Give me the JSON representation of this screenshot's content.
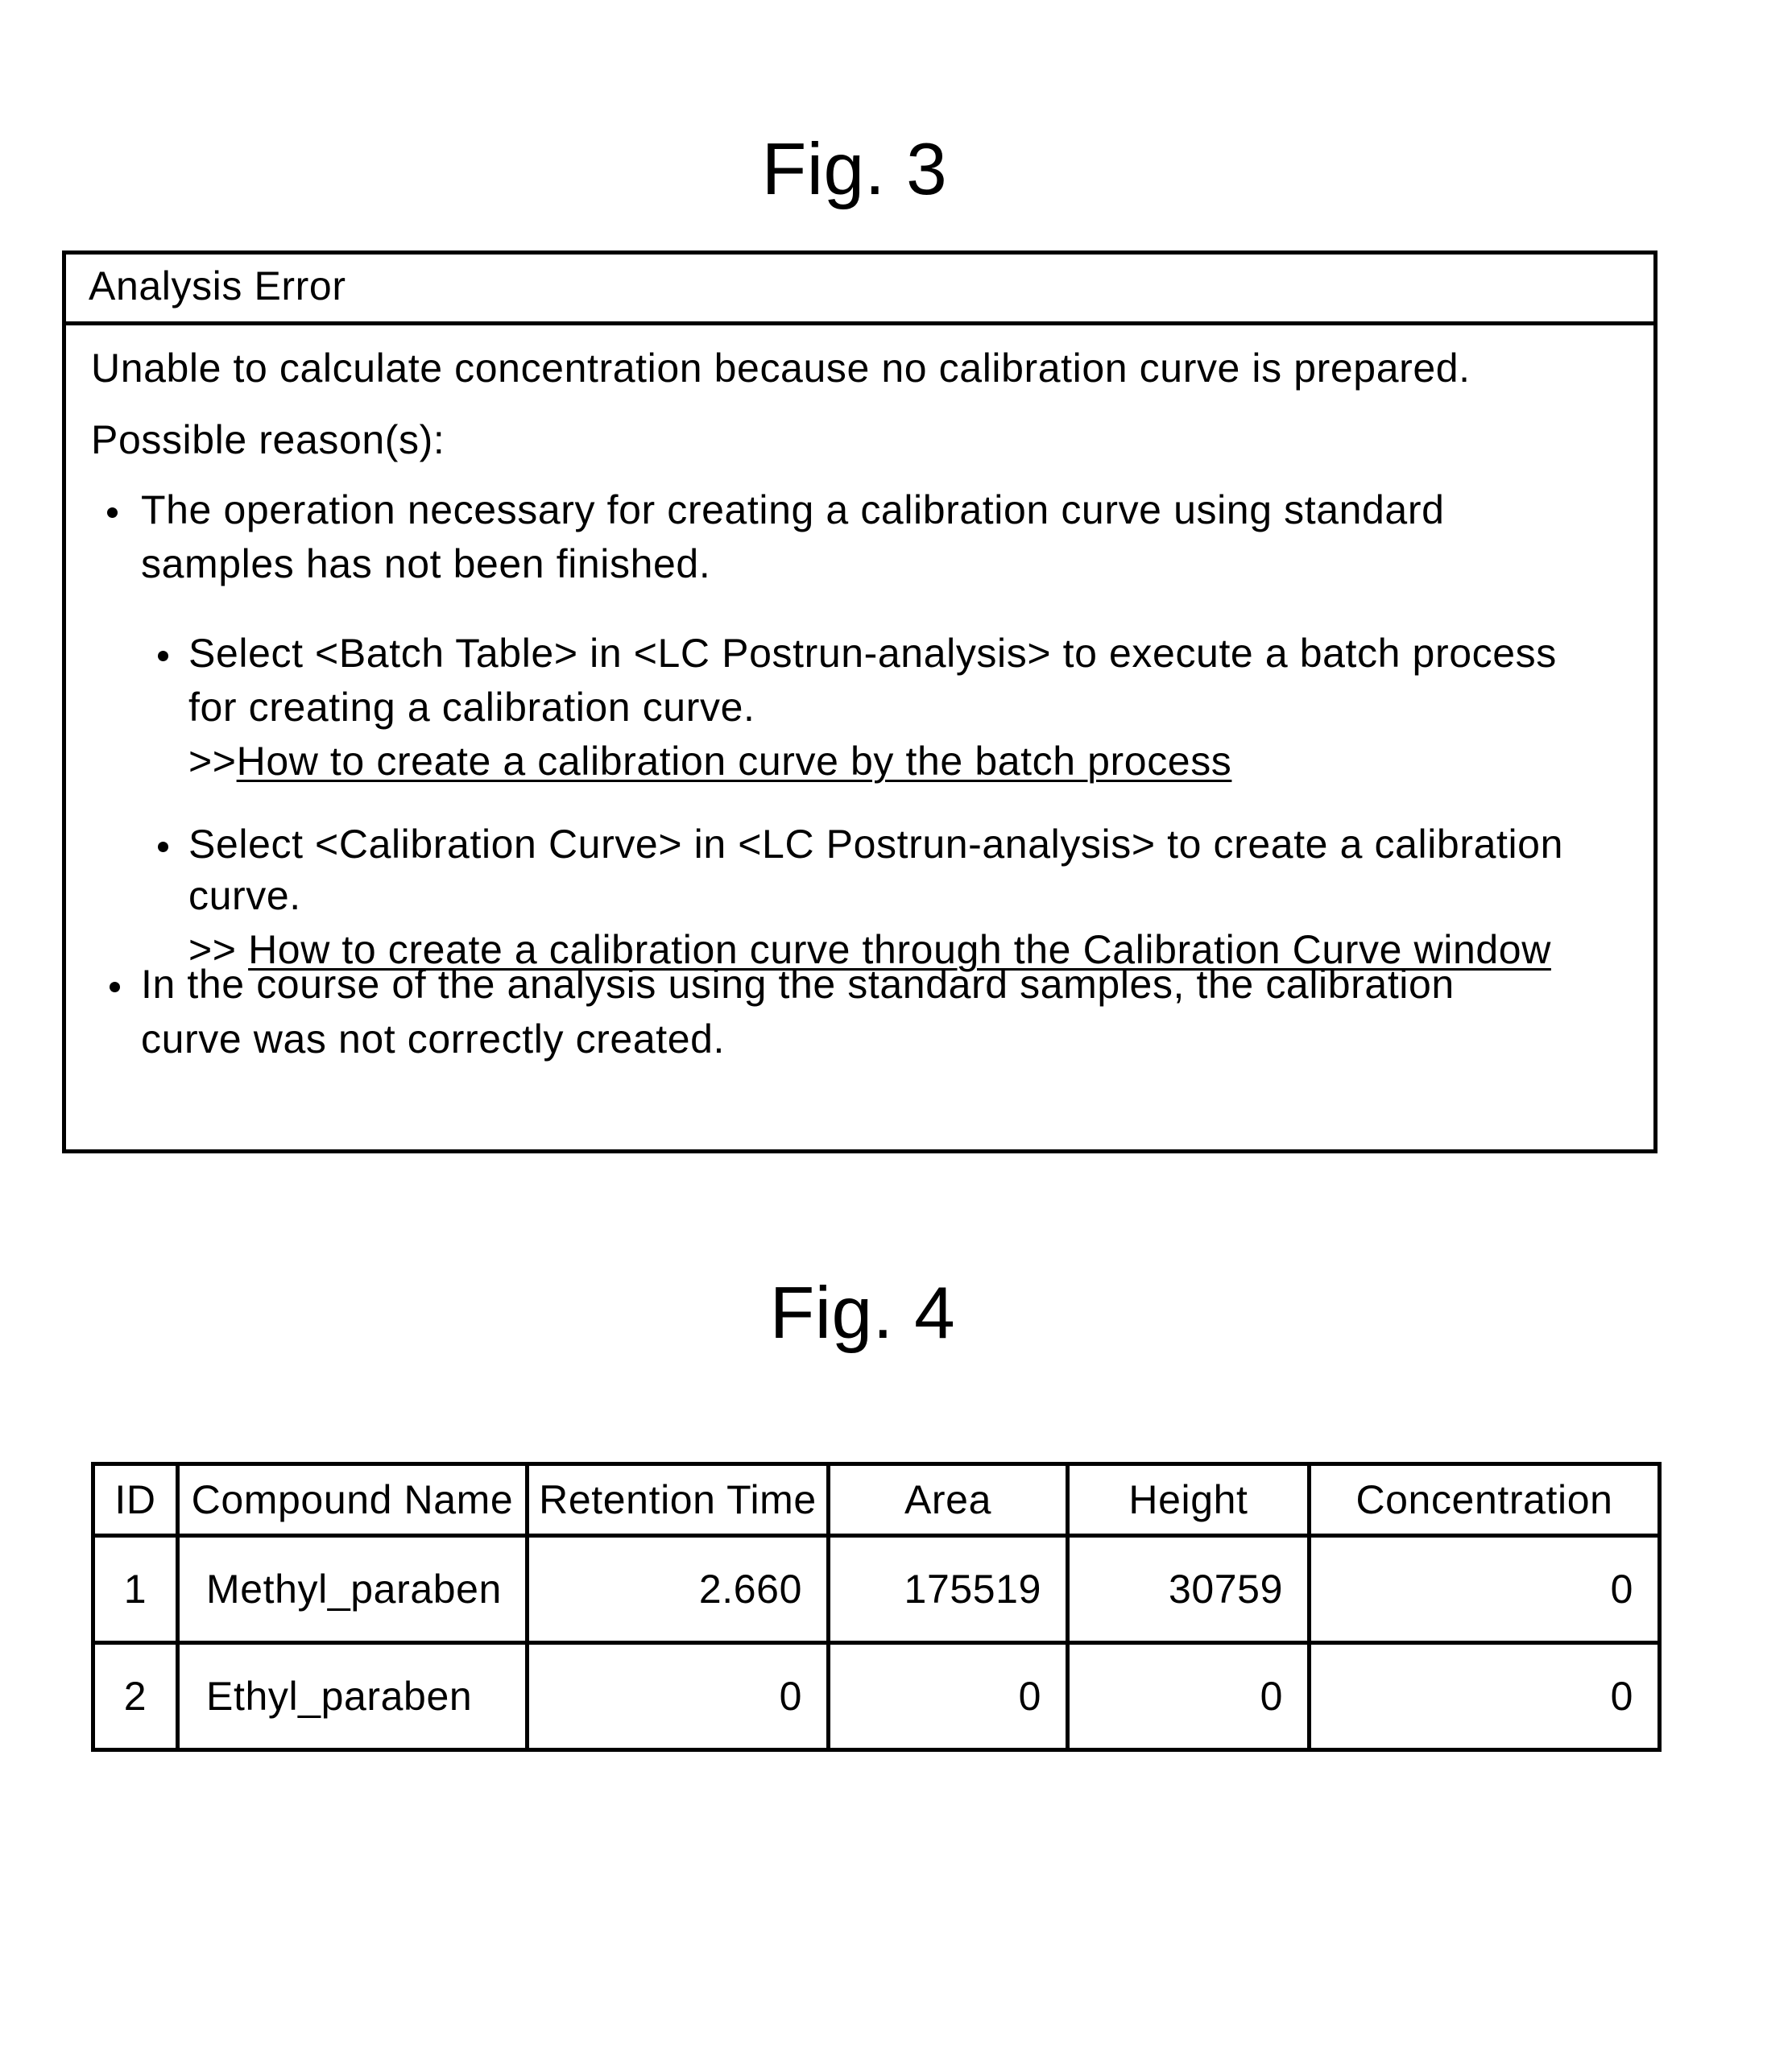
{
  "fig3": {
    "caption": "Fig. 3",
    "dialog": {
      "title": "Analysis Error",
      "message": "Unable to calculate concentration because no calibration curve is prepared.",
      "reasons_label": "Possible reason(s):",
      "reasons": [
        {
          "lines": [
            "The operation necessary for creating a calibration curve using standard",
            "samples has not been finished."
          ],
          "sub_items": [
            {
              "lines": [
                "Select <Batch Table> in <LC Postrun-analysis> to execute a batch process",
                "for creating a calibration curve."
              ],
              "link_prefix": ">>",
              "link_text": "How to create a calibration curve by the batch process"
            },
            {
              "lines": [
                "Select <Calibration Curve> in <LC Postrun-analysis> to create a calibration",
                "curve."
              ],
              "link_prefix": ">> ",
              "link_text": "How to create a calibration curve through the Calibration Curve window"
            }
          ]
        },
        {
          "lines": [
            "In the course of the analysis using the standard samples, the calibration",
            "curve was not correctly created."
          ]
        }
      ]
    }
  },
  "fig4": {
    "caption": "Fig. 4",
    "table": {
      "headers": [
        "ID",
        "Compound Name",
        "Retention Time",
        "Area",
        "Height",
        "Concentration"
      ],
      "rows": [
        [
          "1",
          "Methyl_paraben",
          "2.660",
          "175519",
          "30759",
          "0"
        ],
        [
          "2",
          "Ethyl_paraben",
          "0",
          "0",
          "0",
          "0"
        ]
      ]
    }
  }
}
